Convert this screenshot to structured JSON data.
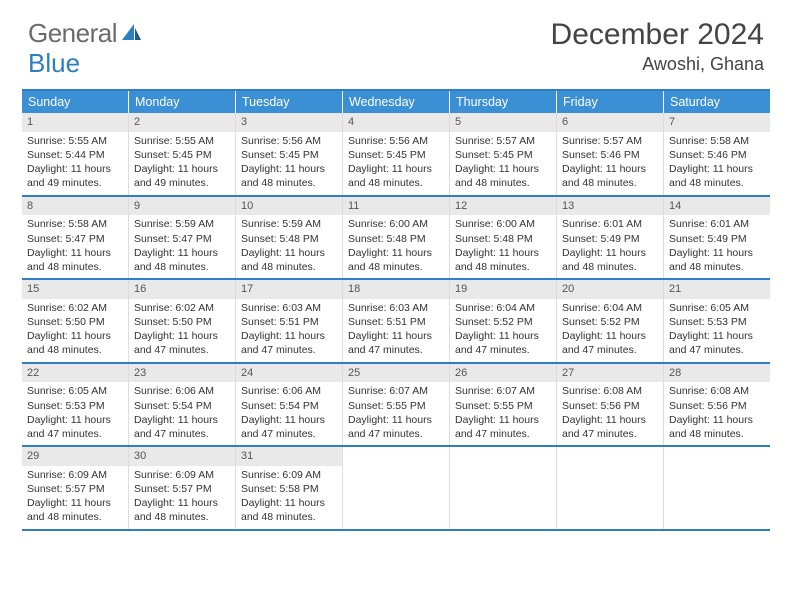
{
  "logo": {
    "part1": "General",
    "part2": "Blue"
  },
  "title": "December 2024",
  "location": "Awoshi, Ghana",
  "day_headers": [
    "Sunday",
    "Monday",
    "Tuesday",
    "Wednesday",
    "Thursday",
    "Friday",
    "Saturday"
  ],
  "weeks": [
    [
      {
        "n": "1",
        "sr": "Sunrise: 5:55 AM",
        "ss": "Sunset: 5:44 PM",
        "dl": "Daylight: 11 hours and 49 minutes."
      },
      {
        "n": "2",
        "sr": "Sunrise: 5:55 AM",
        "ss": "Sunset: 5:45 PM",
        "dl": "Daylight: 11 hours and 49 minutes."
      },
      {
        "n": "3",
        "sr": "Sunrise: 5:56 AM",
        "ss": "Sunset: 5:45 PM",
        "dl": "Daylight: 11 hours and 48 minutes."
      },
      {
        "n": "4",
        "sr": "Sunrise: 5:56 AM",
        "ss": "Sunset: 5:45 PM",
        "dl": "Daylight: 11 hours and 48 minutes."
      },
      {
        "n": "5",
        "sr": "Sunrise: 5:57 AM",
        "ss": "Sunset: 5:45 PM",
        "dl": "Daylight: 11 hours and 48 minutes."
      },
      {
        "n": "6",
        "sr": "Sunrise: 5:57 AM",
        "ss": "Sunset: 5:46 PM",
        "dl": "Daylight: 11 hours and 48 minutes."
      },
      {
        "n": "7",
        "sr": "Sunrise: 5:58 AM",
        "ss": "Sunset: 5:46 PM",
        "dl": "Daylight: 11 hours and 48 minutes."
      }
    ],
    [
      {
        "n": "8",
        "sr": "Sunrise: 5:58 AM",
        "ss": "Sunset: 5:47 PM",
        "dl": "Daylight: 11 hours and 48 minutes."
      },
      {
        "n": "9",
        "sr": "Sunrise: 5:59 AM",
        "ss": "Sunset: 5:47 PM",
        "dl": "Daylight: 11 hours and 48 minutes."
      },
      {
        "n": "10",
        "sr": "Sunrise: 5:59 AM",
        "ss": "Sunset: 5:48 PM",
        "dl": "Daylight: 11 hours and 48 minutes."
      },
      {
        "n": "11",
        "sr": "Sunrise: 6:00 AM",
        "ss": "Sunset: 5:48 PM",
        "dl": "Daylight: 11 hours and 48 minutes."
      },
      {
        "n": "12",
        "sr": "Sunrise: 6:00 AM",
        "ss": "Sunset: 5:48 PM",
        "dl": "Daylight: 11 hours and 48 minutes."
      },
      {
        "n": "13",
        "sr": "Sunrise: 6:01 AM",
        "ss": "Sunset: 5:49 PM",
        "dl": "Daylight: 11 hours and 48 minutes."
      },
      {
        "n": "14",
        "sr": "Sunrise: 6:01 AM",
        "ss": "Sunset: 5:49 PM",
        "dl": "Daylight: 11 hours and 48 minutes."
      }
    ],
    [
      {
        "n": "15",
        "sr": "Sunrise: 6:02 AM",
        "ss": "Sunset: 5:50 PM",
        "dl": "Daylight: 11 hours and 48 minutes."
      },
      {
        "n": "16",
        "sr": "Sunrise: 6:02 AM",
        "ss": "Sunset: 5:50 PM",
        "dl": "Daylight: 11 hours and 47 minutes."
      },
      {
        "n": "17",
        "sr": "Sunrise: 6:03 AM",
        "ss": "Sunset: 5:51 PM",
        "dl": "Daylight: 11 hours and 47 minutes."
      },
      {
        "n": "18",
        "sr": "Sunrise: 6:03 AM",
        "ss": "Sunset: 5:51 PM",
        "dl": "Daylight: 11 hours and 47 minutes."
      },
      {
        "n": "19",
        "sr": "Sunrise: 6:04 AM",
        "ss": "Sunset: 5:52 PM",
        "dl": "Daylight: 11 hours and 47 minutes."
      },
      {
        "n": "20",
        "sr": "Sunrise: 6:04 AM",
        "ss": "Sunset: 5:52 PM",
        "dl": "Daylight: 11 hours and 47 minutes."
      },
      {
        "n": "21",
        "sr": "Sunrise: 6:05 AM",
        "ss": "Sunset: 5:53 PM",
        "dl": "Daylight: 11 hours and 47 minutes."
      }
    ],
    [
      {
        "n": "22",
        "sr": "Sunrise: 6:05 AM",
        "ss": "Sunset: 5:53 PM",
        "dl": "Daylight: 11 hours and 47 minutes."
      },
      {
        "n": "23",
        "sr": "Sunrise: 6:06 AM",
        "ss": "Sunset: 5:54 PM",
        "dl": "Daylight: 11 hours and 47 minutes."
      },
      {
        "n": "24",
        "sr": "Sunrise: 6:06 AM",
        "ss": "Sunset: 5:54 PM",
        "dl": "Daylight: 11 hours and 47 minutes."
      },
      {
        "n": "25",
        "sr": "Sunrise: 6:07 AM",
        "ss": "Sunset: 5:55 PM",
        "dl": "Daylight: 11 hours and 47 minutes."
      },
      {
        "n": "26",
        "sr": "Sunrise: 6:07 AM",
        "ss": "Sunset: 5:55 PM",
        "dl": "Daylight: 11 hours and 47 minutes."
      },
      {
        "n": "27",
        "sr": "Sunrise: 6:08 AM",
        "ss": "Sunset: 5:56 PM",
        "dl": "Daylight: 11 hours and 47 minutes."
      },
      {
        "n": "28",
        "sr": "Sunrise: 6:08 AM",
        "ss": "Sunset: 5:56 PM",
        "dl": "Daylight: 11 hours and 48 minutes."
      }
    ],
    [
      {
        "n": "29",
        "sr": "Sunrise: 6:09 AM",
        "ss": "Sunset: 5:57 PM",
        "dl": "Daylight: 11 hours and 48 minutes."
      },
      {
        "n": "30",
        "sr": "Sunrise: 6:09 AM",
        "ss": "Sunset: 5:57 PM",
        "dl": "Daylight: 11 hours and 48 minutes."
      },
      {
        "n": "31",
        "sr": "Sunrise: 6:09 AM",
        "ss": "Sunset: 5:58 PM",
        "dl": "Daylight: 11 hours and 48 minutes."
      },
      null,
      null,
      null,
      null
    ]
  ]
}
